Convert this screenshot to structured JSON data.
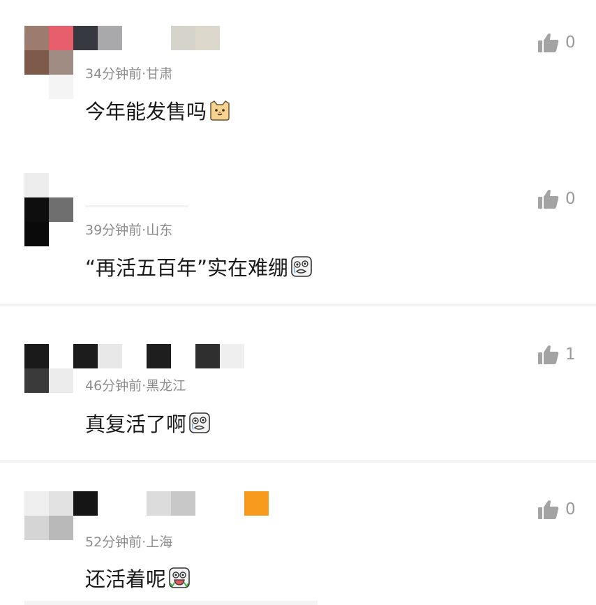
{
  "comments": [
    {
      "meta": "34分钟前·甘肃",
      "text": "今年能发售吗",
      "emoji": "cat-face-emoji",
      "likes": "0"
    },
    {
      "meta": "39分钟前·山东",
      "text": "“再活五百年”实在难绷",
      "emoji": "crying-face-emoji",
      "likes": "0"
    },
    {
      "meta": "46分钟前·黑龙江",
      "text": "真复活了啊",
      "emoji": "crying-face-emoji",
      "likes": "1"
    },
    {
      "meta": "52分钟前·上海",
      "text": "还活着呢",
      "emoji": "laughing-face-emoji",
      "likes": "0"
    }
  ],
  "icons": {
    "like": "thumbs-up-icon"
  },
  "colors": {
    "meta": "#8c8c8c",
    "text": "#1a1a1a",
    "like": "#9a9a9a",
    "divider": "#f4f4f4"
  }
}
